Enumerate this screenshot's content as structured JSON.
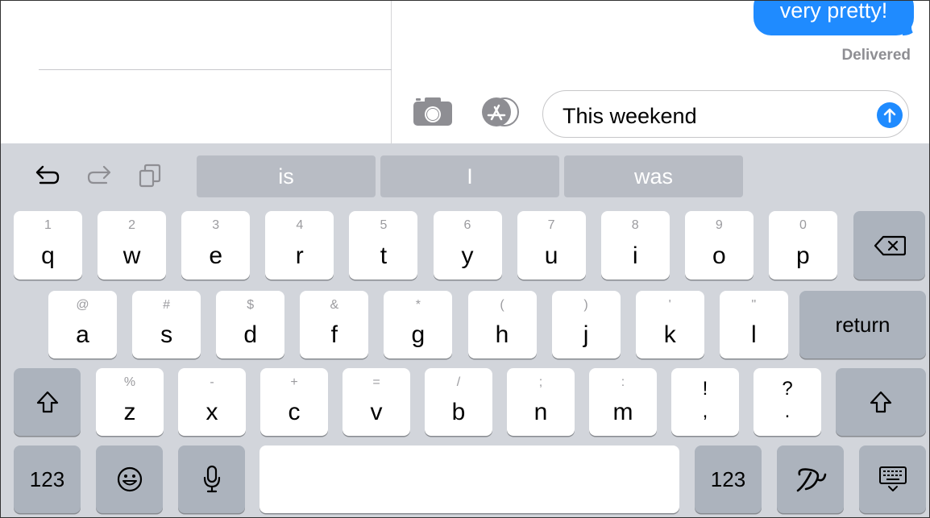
{
  "conversation": {
    "last_message": "very pretty!",
    "status": "Delivered"
  },
  "compose": {
    "text": "This weekend"
  },
  "predictive": {
    "suggestions": [
      "is",
      "I",
      "was"
    ]
  },
  "keyboard": {
    "row1": [
      {
        "hint": "1",
        "main": "q"
      },
      {
        "hint": "2",
        "main": "w"
      },
      {
        "hint": "3",
        "main": "e"
      },
      {
        "hint": "4",
        "main": "r"
      },
      {
        "hint": "5",
        "main": "t"
      },
      {
        "hint": "6",
        "main": "y"
      },
      {
        "hint": "7",
        "main": "u"
      },
      {
        "hint": "8",
        "main": "i"
      },
      {
        "hint": "9",
        "main": "o"
      },
      {
        "hint": "0",
        "main": "p"
      }
    ],
    "row2": [
      {
        "hint": "@",
        "main": "a"
      },
      {
        "hint": "#",
        "main": "s"
      },
      {
        "hint": "$",
        "main": "d"
      },
      {
        "hint": "&",
        "main": "f"
      },
      {
        "hint": "*",
        "main": "g"
      },
      {
        "hint": "(",
        "main": "h"
      },
      {
        "hint": ")",
        "main": "j"
      },
      {
        "hint": "'",
        "main": "k"
      },
      {
        "hint": "\"",
        "main": "l"
      }
    ],
    "return_label": "return",
    "row3": [
      {
        "hint": "%",
        "main": "z"
      },
      {
        "hint": "-",
        "main": "x"
      },
      {
        "hint": "+",
        "main": "c"
      },
      {
        "hint": "=",
        "main": "v"
      },
      {
        "hint": "/",
        "main": "b"
      },
      {
        "hint": ";",
        "main": "n"
      },
      {
        "hint": ":",
        "main": "m"
      },
      {
        "hint": "!",
        "main": ","
      },
      {
        "hint": "?",
        "main": "."
      }
    ],
    "numbers_label": "123",
    "numbers_label_right": "123"
  },
  "icons": {
    "undo": "undo-icon",
    "redo": "redo-icon",
    "paste": "paste-icon",
    "camera": "camera-icon",
    "app_store": "app-store-icon",
    "send": "send-arrow-icon",
    "delete": "delete-icon",
    "shift": "shift-icon",
    "emoji": "emoji-icon",
    "dictation": "microphone-icon",
    "handwriting": "handwriting-icon",
    "hide_keyboard": "hide-keyboard-icon"
  },
  "colors": {
    "accent": "#1f8bff",
    "keyboard_bg": "#d2d5db",
    "key_bg": "#ffffff",
    "function_key_bg": "#acb3bd"
  }
}
